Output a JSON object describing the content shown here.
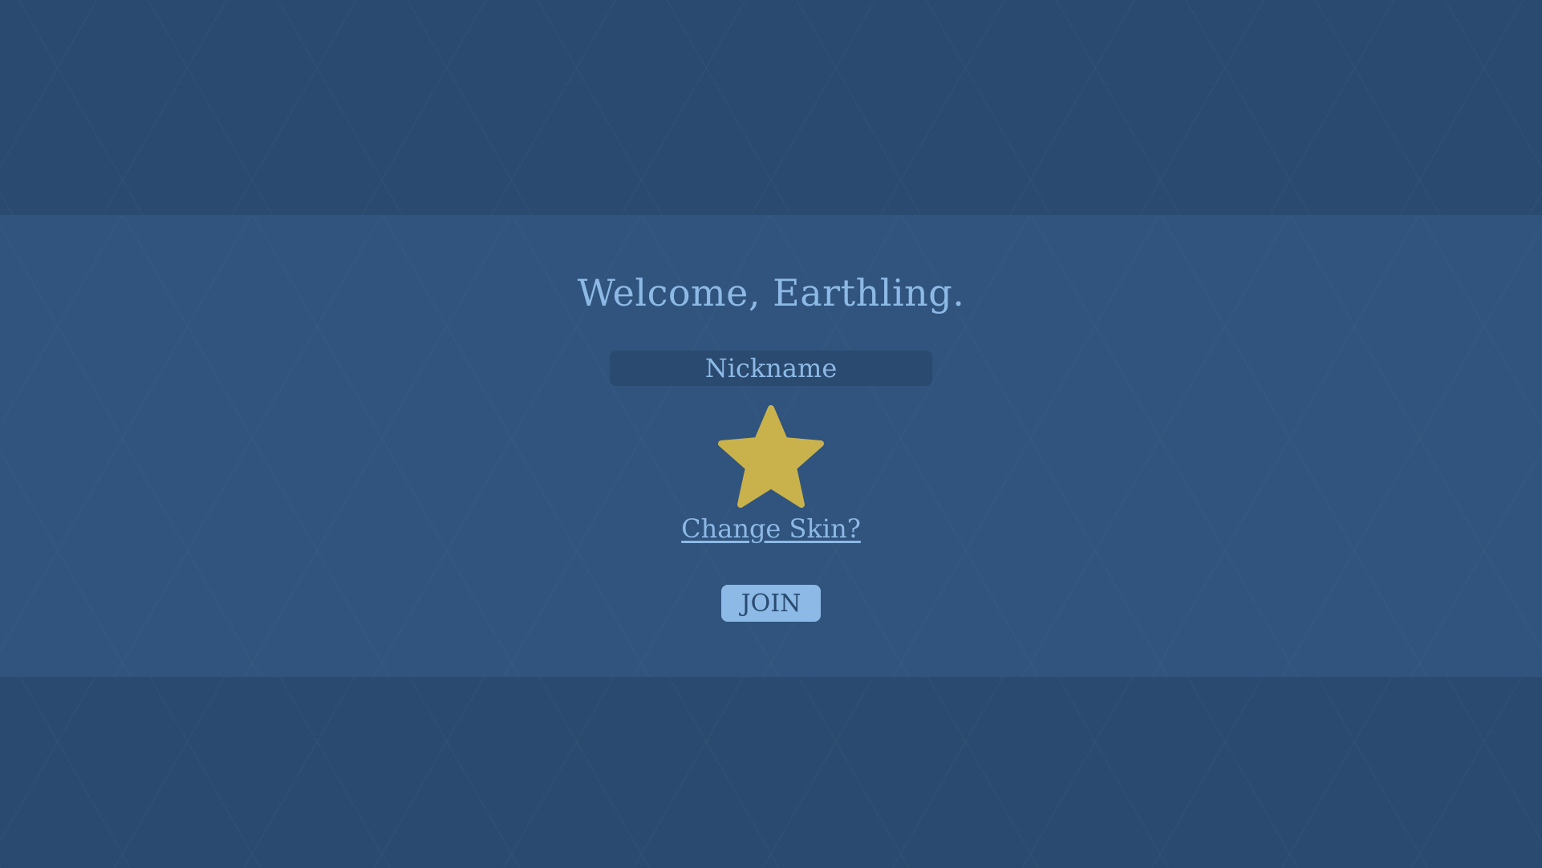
{
  "welcome": {
    "title": "Welcome, Earthling."
  },
  "nickname": {
    "placeholder": "Nickname",
    "value": ""
  },
  "skin": {
    "icon": "star-icon",
    "color": "#c9b24c",
    "change_label": "Change Skin?"
  },
  "join": {
    "label": "JOIN"
  },
  "colors": {
    "background": "#2a4a6f",
    "band": "#30547d",
    "text": "#8db9e6",
    "button": "#8db9e6",
    "input": "#2a4a6f"
  }
}
